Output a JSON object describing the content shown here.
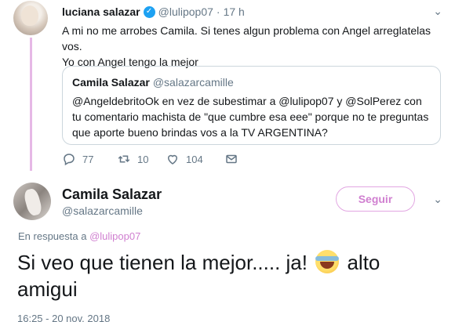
{
  "reply_tweet": {
    "author_name": "luciana salazar",
    "verified_icon": "check-icon",
    "handle": "@lulipop07",
    "separator": "·",
    "time": "17 h",
    "text_line1": "A mi no me arrobes Camila. Si tenes algun problema con Angel arreglatelas vos.",
    "text_line2": "Yo con Angel tengo la mejor",
    "quoted": {
      "author_name": "Camila Salazar",
      "handle": "@salazarcamille",
      "text": "@AngeldebritoOk en vez de subestimar a @lulipop07 y @SolPerez con tu comentario machista de \"que cumbre esa eee\" porque no te preguntas que aporte bueno brindas vos a la TV ARGENTINA?"
    },
    "actions": {
      "reply_count": "77",
      "retweet_count": "10",
      "like_count": "104"
    },
    "colors": {
      "thread_line": "#e6b8e6",
      "verified": "#1da1f2"
    }
  },
  "main_tweet": {
    "author_name": "Camila Salazar",
    "handle": "@salazarcamille",
    "follow_label": "Seguir",
    "reply_prefix": "En respuesta a",
    "reply_handle": "@lulipop07",
    "text_before_emoji": "Si veo que tienen la mejor..... ja!",
    "emoji": "😂",
    "text_after_emoji": "alto amigui",
    "timestamp": "16:25 - 20 nov. 2018",
    "colors": {
      "accent": "#d07fd0"
    }
  }
}
